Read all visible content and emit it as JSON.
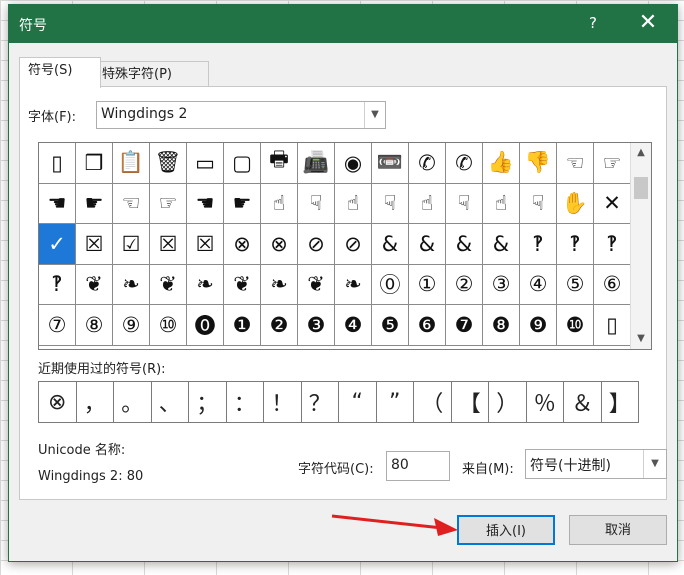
{
  "title": "符号",
  "help_label": "?",
  "close_label": "✕",
  "tabs": [
    "符号(S)",
    "特殊字符(P)"
  ],
  "font_label": "字体(F):",
  "font_value": "Wingdings 2",
  "symbols": [
    "▯",
    "❒",
    "📋",
    "🗑",
    "▭",
    "▢",
    "🖶",
    "📠",
    "◉",
    "📼",
    "✆",
    "✆",
    "👍",
    "👎",
    "☜",
    "☞",
    "☚",
    "☛",
    "☜",
    "☞",
    "☚",
    "☛",
    "☝",
    "☟",
    "☝",
    "☟",
    "☝",
    "☟",
    "☝",
    "☟",
    "✋",
    "✕",
    "✓",
    "☒",
    "☑",
    "☒",
    "☒",
    "⊗",
    "⊗",
    "⊘",
    "⊘",
    "&",
    "&",
    "&",
    "&",
    "‽",
    "‽",
    "‽",
    "‽",
    "❦",
    "❧",
    "❦",
    "❧",
    "❦",
    "❧",
    "❦",
    "❧",
    "⓪",
    "①",
    "②",
    "③",
    "④",
    "⑤",
    "⑥",
    "⑦",
    "⑧",
    "⑨",
    "⑩",
    "⓿",
    "❶",
    "❷",
    "❸",
    "❹",
    "❺",
    "❻",
    "❼",
    "❽",
    "❾",
    "❿",
    "▯"
  ],
  "recent_label": "近期使用过的符号(R):",
  "recent_symbols": [
    "⊗",
    "，",
    "。",
    "、",
    "；",
    "：",
    "！",
    "？",
    "“",
    "”",
    "（",
    "【",
    "）",
    "％",
    "＆",
    "】"
  ],
  "unicode_label": "Unicode 名称:",
  "unicode_value": "Wingdings 2: 80",
  "charcode_label": "字符代码(C):",
  "charcode_value": "80",
  "from_label": "来自(M):",
  "from_value": "符号(十进制)",
  "insert_label": "插入(I)",
  "cancel_label": "取消",
  "colors": {
    "accent": "#217346",
    "selection": "#1e78d7",
    "arrow": "#e02020"
  }
}
